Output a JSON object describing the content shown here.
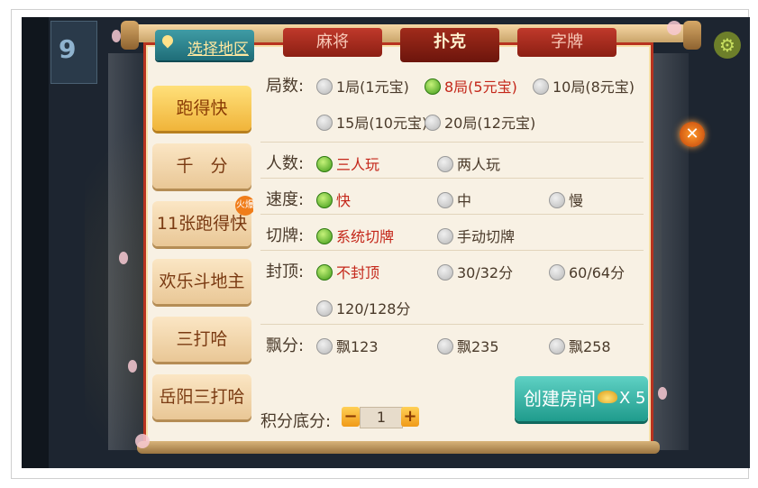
{
  "region_tab": {
    "label": "选择地区"
  },
  "game_tabs": [
    {
      "label": "麻将",
      "active": false
    },
    {
      "label": "扑克",
      "active": true
    },
    {
      "label": "字牌",
      "active": false
    }
  ],
  "sidebar": {
    "items": [
      {
        "label": "跑得快",
        "active": true
      },
      {
        "label": "千　分",
        "active": false
      },
      {
        "label": "11张跑得快",
        "active": false,
        "badge": "火爆"
      },
      {
        "label": "欢乐斗地主",
        "active": false
      },
      {
        "label": "三打哈",
        "active": false
      },
      {
        "label": "岳阳三打哈",
        "active": false
      }
    ]
  },
  "options": {
    "rounds": {
      "label": "局数:",
      "choices": [
        {
          "text": "1局(1元宝)",
          "selected": false
        },
        {
          "text": "8局(5元宝)",
          "selected": true
        },
        {
          "text": "10局(8元宝)",
          "selected": false
        },
        {
          "text": "15局(10元宝)",
          "selected": false
        },
        {
          "text": "20局(12元宝)",
          "selected": false
        }
      ]
    },
    "players": {
      "label": "人数:",
      "choices": [
        {
          "text": "三人玩",
          "selected": true
        },
        {
          "text": "两人玩",
          "selected": false
        }
      ]
    },
    "speed": {
      "label": "速度:",
      "choices": [
        {
          "text": "快",
          "selected": true
        },
        {
          "text": "中",
          "selected": false
        },
        {
          "text": "慢",
          "selected": false
        }
      ]
    },
    "cut": {
      "label": "切牌:",
      "choices": [
        {
          "text": "系统切牌",
          "selected": true
        },
        {
          "text": "手动切牌",
          "selected": false
        }
      ]
    },
    "cap": {
      "label": "封顶:",
      "choices": [
        {
          "text": "不封顶",
          "selected": true
        },
        {
          "text": "30/32分",
          "selected": false
        },
        {
          "text": "60/64分",
          "selected": false
        },
        {
          "text": "120/128分",
          "selected": false
        }
      ]
    },
    "float": {
      "label": "飘分:",
      "choices": [
        {
          "text": "飘123",
          "selected": false
        },
        {
          "text": "飘235",
          "selected": false
        },
        {
          "text": "飘258",
          "selected": false
        }
      ]
    },
    "base_score": {
      "label": "积分底分:",
      "value": "1",
      "minus": "−",
      "plus": "+"
    }
  },
  "create_button": {
    "label": "创建房间",
    "cost": "X 5"
  },
  "colors": {
    "accent_red": "#c4271a",
    "selected_green": "#3e9a18",
    "teal": "#1f9b8c"
  },
  "icons": [
    "location-pin-icon",
    "gear-icon",
    "close-icon",
    "gold-ingot-icon"
  ]
}
